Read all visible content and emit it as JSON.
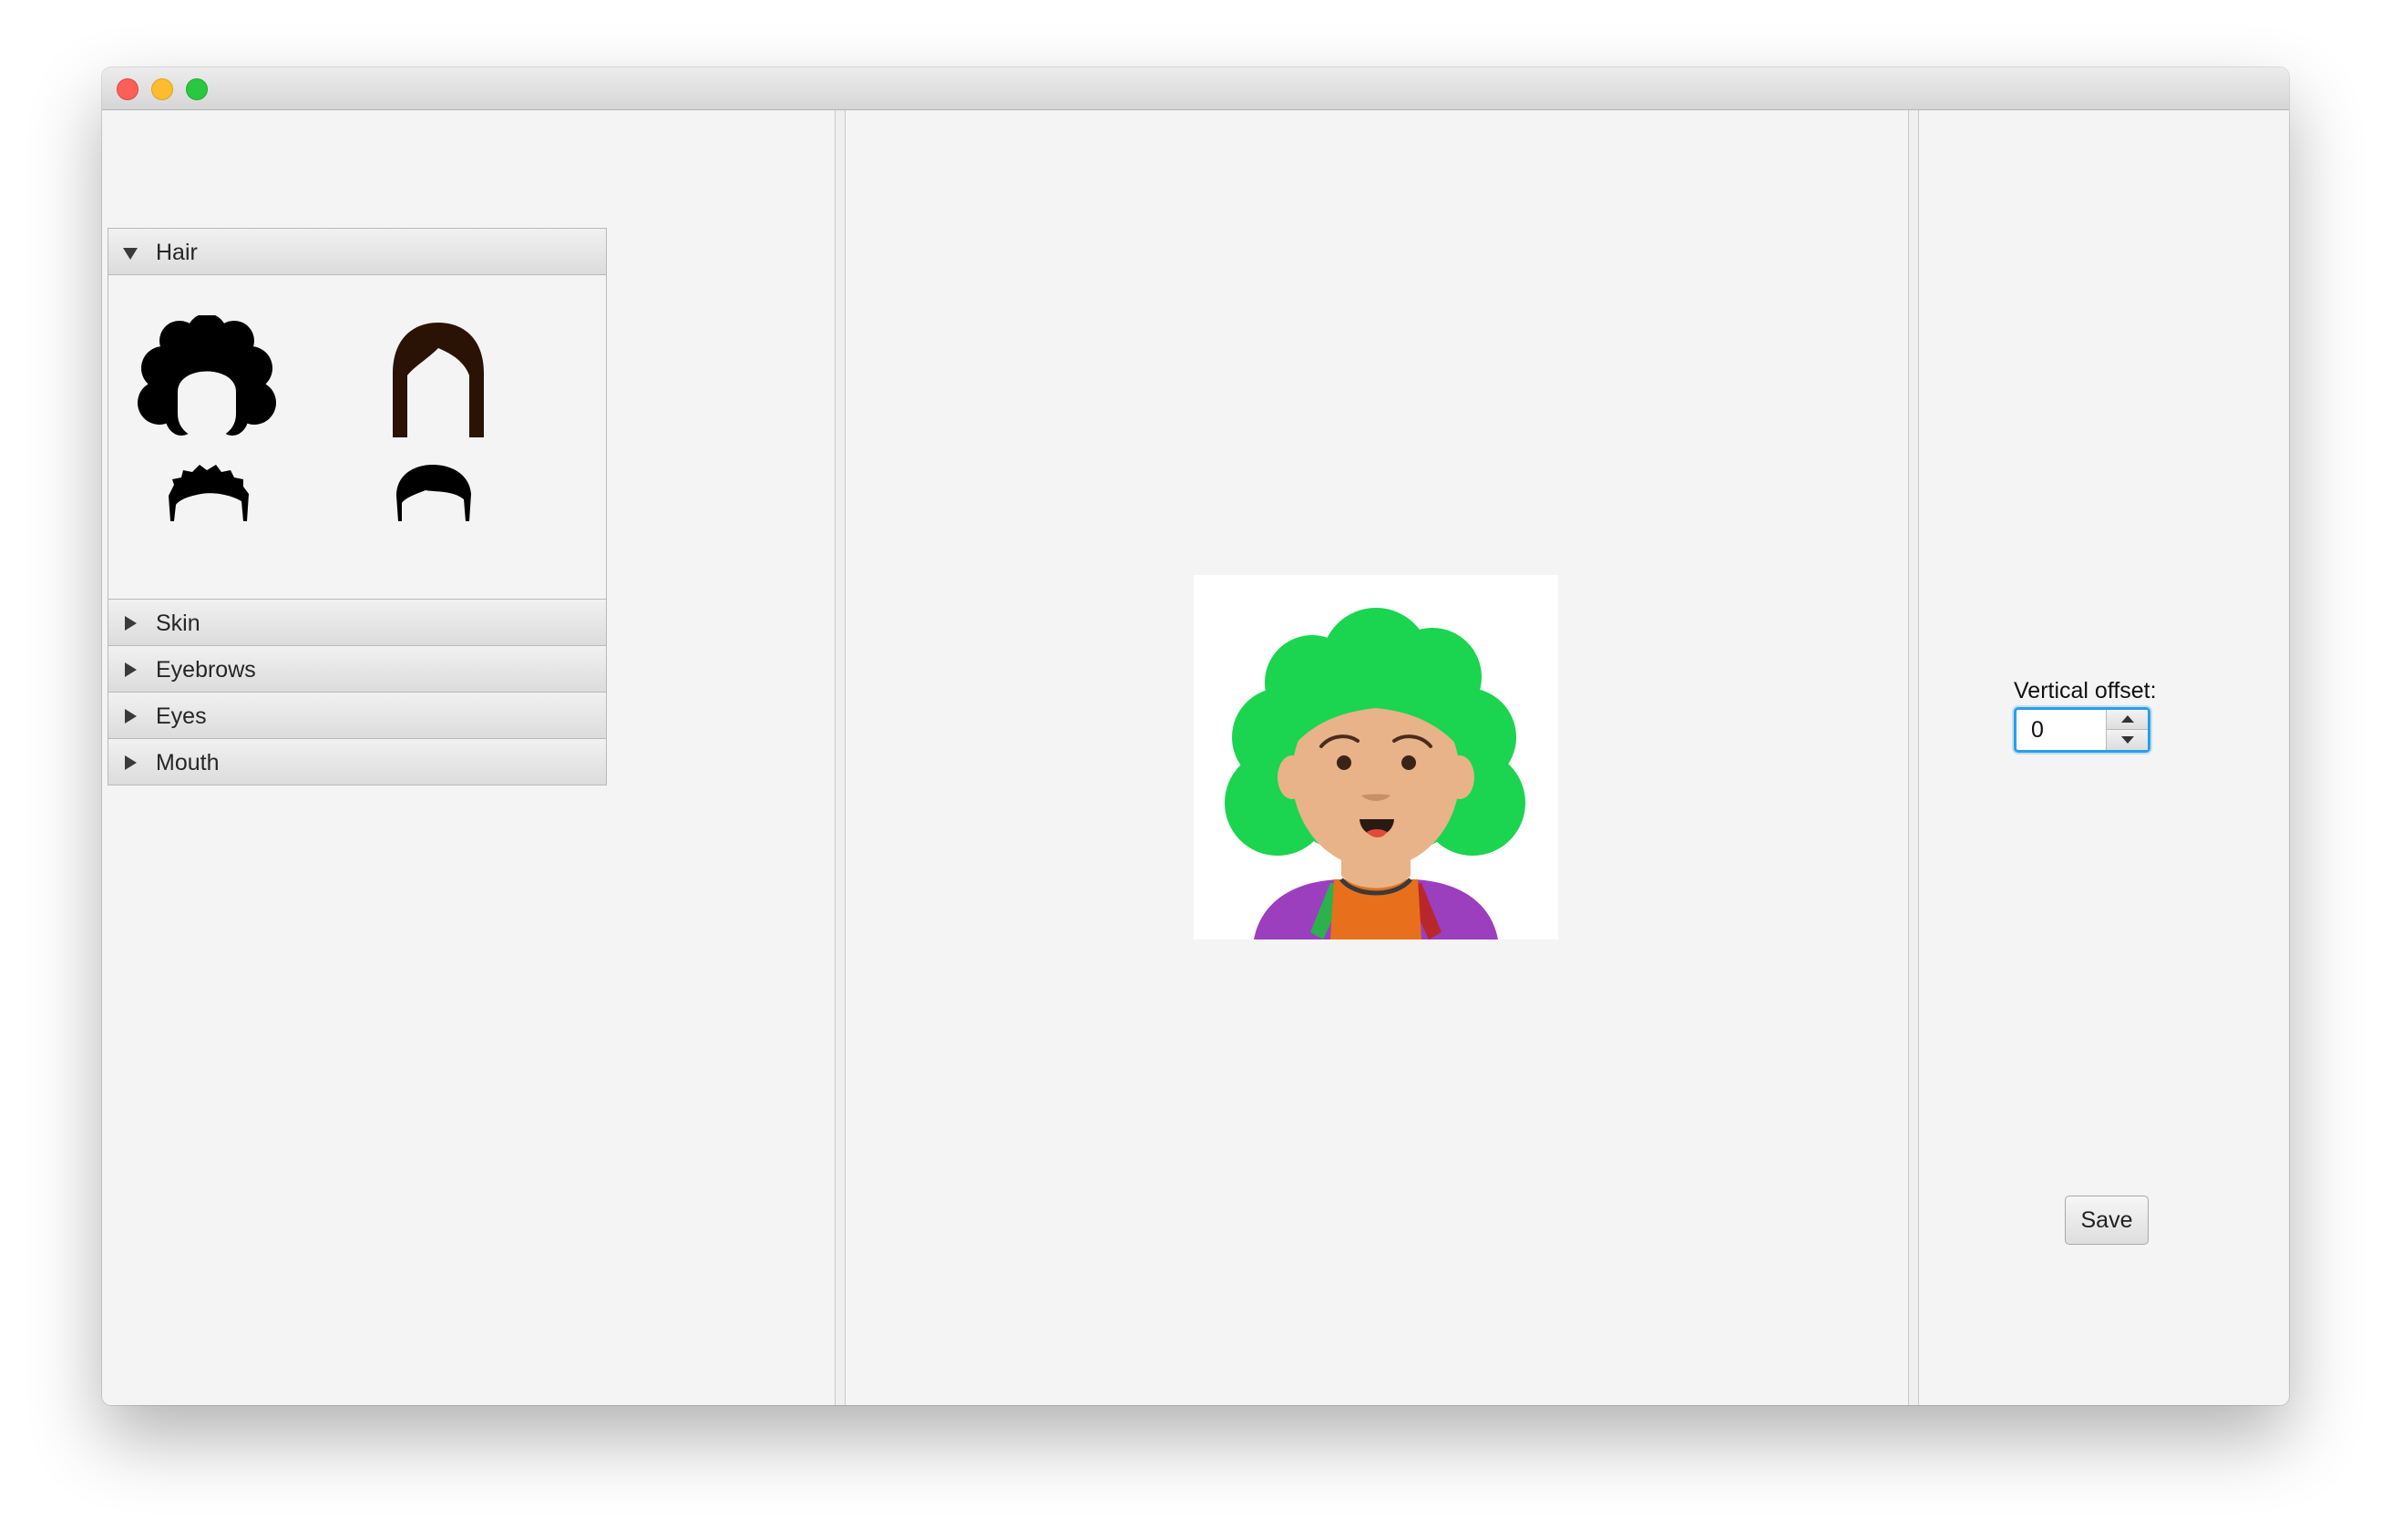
{
  "accordion": {
    "sections": [
      {
        "label": "Hair",
        "expanded": true
      },
      {
        "label": "Skin",
        "expanded": false
      },
      {
        "label": "Eyebrows",
        "expanded": false
      },
      {
        "label": "Eyes",
        "expanded": false
      },
      {
        "label": "Mouth",
        "expanded": false
      }
    ],
    "hair_options": [
      {
        "icon": "curly-hair-icon",
        "color": "#000000"
      },
      {
        "icon": "long-hair-icon",
        "color": "#2a1205"
      },
      {
        "icon": "spiky-short-hair-icon",
        "color": "#000000"
      },
      {
        "icon": "short-hair-icon",
        "color": "#000000"
      }
    ]
  },
  "preview": {
    "hair_color": "#1bd44f",
    "skin_color": "#e8b388",
    "shirt_color": "#e8701c",
    "jacket_color": "#9b3fbf"
  },
  "controls": {
    "vertical_offset_label": "Vertical offset:",
    "vertical_offset_value": "0",
    "save_label": "Save"
  }
}
